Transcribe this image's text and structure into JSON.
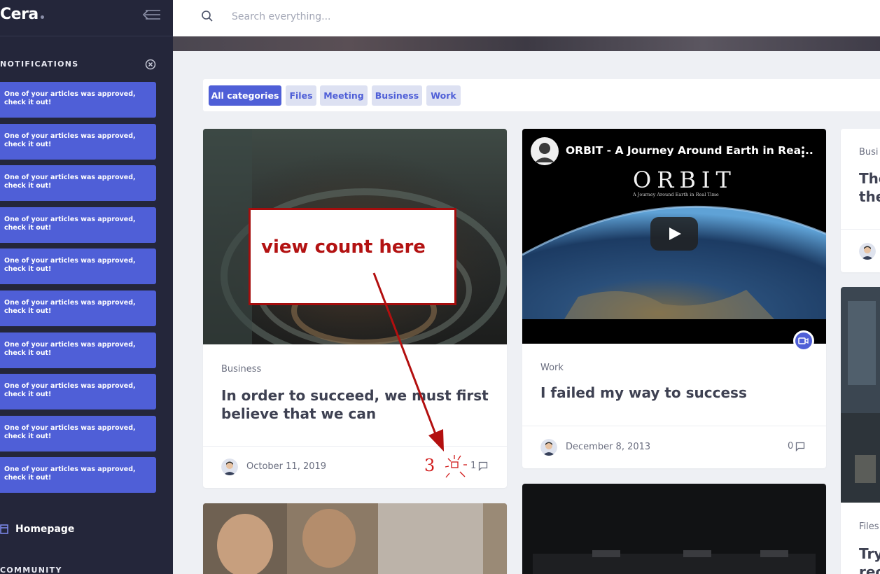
{
  "app": {
    "name": "Cera"
  },
  "search": {
    "placeholder": "Search everything..."
  },
  "sidebar": {
    "notifications_title": "NOTIFICATIONS",
    "notifications": [
      "One of your articles was approved, check it out!",
      "One of your articles was approved, check it out!",
      "One of your articles was approved, check it out!",
      "One of your articles was approved, check it out!",
      "One of your articles was approved, check it out!",
      "One of your articles was approved, check it out!",
      "One of your articles was approved, check it out!",
      "One of your articles was approved, check it out!",
      "One of your articles was approved, check it out!",
      "One of your articles was approved, check it out!"
    ],
    "homepage_label": "Homepage",
    "community_title": "COMMUNITY"
  },
  "categories": [
    {
      "label": "All categories",
      "active": true
    },
    {
      "label": "Files",
      "active": false
    },
    {
      "label": "Meeting",
      "active": false
    },
    {
      "label": "Business",
      "active": false
    },
    {
      "label": "Work",
      "active": false
    }
  ],
  "cards": {
    "card1": {
      "category": "Business",
      "title": "In order to succeed, we must first believe that we can",
      "date": "October 11, 2019",
      "comments": "1"
    },
    "card2": {
      "video_title": "ORBIT - A Journey Around Earth in Rea...",
      "video_logo": "ORBIT",
      "video_logo_sub": "A Journey Around Earth in Real Time",
      "category": "Work",
      "title": "I failed my way to success",
      "date": "December 8, 2013",
      "comments": "0"
    },
    "card3": {
      "category": "Busi",
      "title_line1": "The",
      "title_line2": "the"
    },
    "card4": {
      "category": "Files",
      "title_line1": "Try",
      "title_line2": "rec"
    }
  },
  "annotation": {
    "label": "view count here",
    "handwritten_count": "3"
  },
  "colors": {
    "accent": "#4f5fd7",
    "sidebar_bg": "#24263a",
    "annotation_red": "#b31212"
  }
}
